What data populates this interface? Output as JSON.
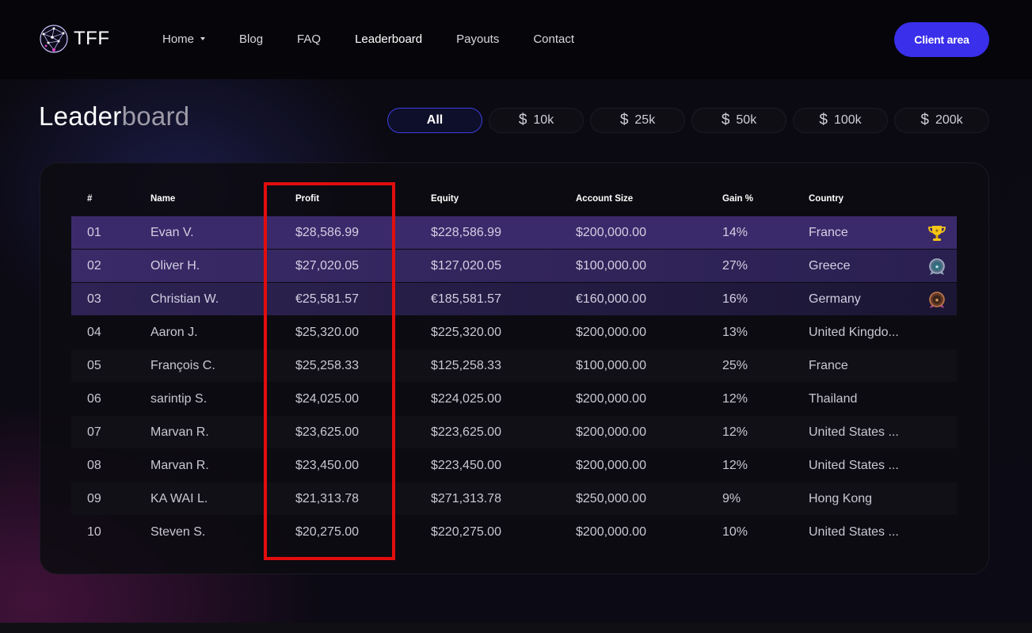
{
  "brand": {
    "name": "TFF",
    "logo_icon": "network-globe-logo"
  },
  "nav": {
    "items": [
      {
        "label": "Home",
        "dropdown": true
      },
      {
        "label": "Blog"
      },
      {
        "label": "FAQ"
      },
      {
        "label": "Leaderboard",
        "active": true
      },
      {
        "label": "Payouts"
      },
      {
        "label": "Contact"
      }
    ],
    "client_button": "Client area"
  },
  "page": {
    "title_part1": "Leader",
    "title_part2": "board"
  },
  "filters": [
    {
      "label": "All",
      "active": true,
      "icon": ""
    },
    {
      "label": "10k",
      "icon": "$"
    },
    {
      "label": "25k",
      "icon": "$"
    },
    {
      "label": "50k",
      "icon": "$"
    },
    {
      "label": "100k",
      "icon": "$"
    },
    {
      "label": "200k",
      "icon": "$"
    }
  ],
  "table": {
    "columns": [
      "#",
      "Name",
      "Profit",
      "Equity",
      "Account Size",
      "Gain %",
      "Country"
    ],
    "rows": [
      {
        "rank": "01",
        "name": "Evan V.",
        "profit": "$28,586.99",
        "equity": "$228,586.99",
        "account_size": "$200,000.00",
        "gain": "14%",
        "country": "France",
        "medal": "trophy-icon"
      },
      {
        "rank": "02",
        "name": "Oliver H.",
        "profit": "$27,020.05",
        "equity": "$127,020.05",
        "account_size": "$100,000.00",
        "gain": "27%",
        "country": "Greece",
        "medal": "silver-medal-icon"
      },
      {
        "rank": "03",
        "name": "Christian W.",
        "profit": "€25,581.57",
        "equity": "€185,581.57",
        "account_size": "€160,000.00",
        "gain": "16%",
        "country": "Germany",
        "medal": "bronze-medal-icon"
      },
      {
        "rank": "04",
        "name": "Aaron J.",
        "profit": "$25,320.00",
        "equity": "$225,320.00",
        "account_size": "$200,000.00",
        "gain": "13%",
        "country": "United Kingdo..."
      },
      {
        "rank": "05",
        "name": "François C.",
        "profit": "$25,258.33",
        "equity": "$125,258.33",
        "account_size": "$100,000.00",
        "gain": "25%",
        "country": "France"
      },
      {
        "rank": "06",
        "name": "sarintip S.",
        "profit": "$24,025.00",
        "equity": "$224,025.00",
        "account_size": "$200,000.00",
        "gain": "12%",
        "country": "Thailand"
      },
      {
        "rank": "07",
        "name": "Marvan R.",
        "profit": "$23,625.00",
        "equity": "$223,625.00",
        "account_size": "$200,000.00",
        "gain": "12%",
        "country": "United States ..."
      },
      {
        "rank": "08",
        "name": "Marvan R.",
        "profit": "$23,450.00",
        "equity": "$223,450.00",
        "account_size": "$200,000.00",
        "gain": "12%",
        "country": "United States ..."
      },
      {
        "rank": "09",
        "name": "KA WAI L.",
        "profit": "$21,313.78",
        "equity": "$271,313.78",
        "account_size": "$250,000.00",
        "gain": "9%",
        "country": "Hong Kong"
      },
      {
        "rank": "10",
        "name": "Steven S.",
        "profit": "$20,275.00",
        "equity": "$220,275.00",
        "account_size": "$200,000.00",
        "gain": "10%",
        "country": "United States ..."
      }
    ]
  },
  "colors": {
    "accent": "#3a2fea",
    "highlight": "#e20d0d",
    "top_row": "#3b2a6b",
    "trophy": "#f5c518"
  }
}
